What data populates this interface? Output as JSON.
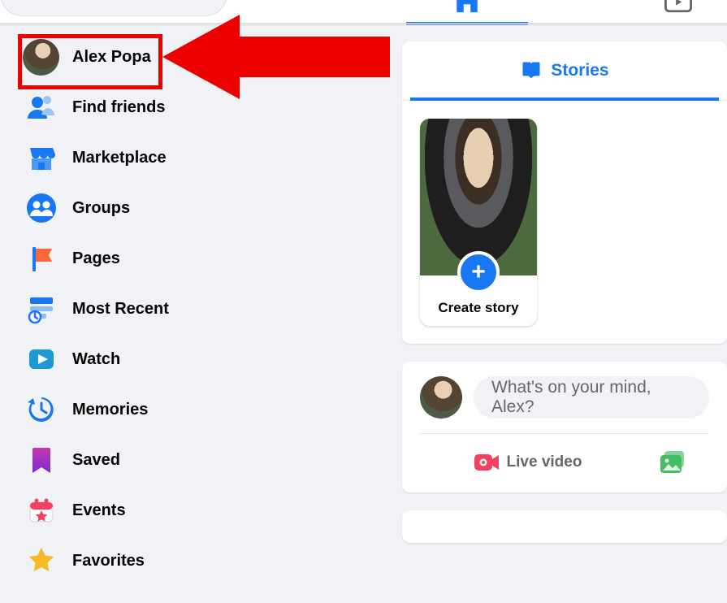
{
  "user": {
    "name": "Alex Popa",
    "first_name": "Alex"
  },
  "sidebar": {
    "items": [
      {
        "label": "Alex Popa",
        "icon": "avatar"
      },
      {
        "label": "Find friends",
        "icon": "friends"
      },
      {
        "label": "Marketplace",
        "icon": "marketplace"
      },
      {
        "label": "Groups",
        "icon": "groups"
      },
      {
        "label": "Pages",
        "icon": "pages"
      },
      {
        "label": "Most Recent",
        "icon": "most-recent"
      },
      {
        "label": "Watch",
        "icon": "watch"
      },
      {
        "label": "Memories",
        "icon": "memories"
      },
      {
        "label": "Saved",
        "icon": "saved"
      },
      {
        "label": "Events",
        "icon": "events"
      },
      {
        "label": "Favorites",
        "icon": "favorites"
      }
    ]
  },
  "stories": {
    "tab_label": "Stories",
    "create_label": "Create story"
  },
  "composer": {
    "placeholder": "What's on your mind, Alex?",
    "live_video_label": "Live video",
    "photo_video_label": "Photo/video"
  },
  "colors": {
    "accent": "#1877f2",
    "annotation": "#ec0000",
    "live": "#f3425f",
    "photo": "#45bd62"
  }
}
